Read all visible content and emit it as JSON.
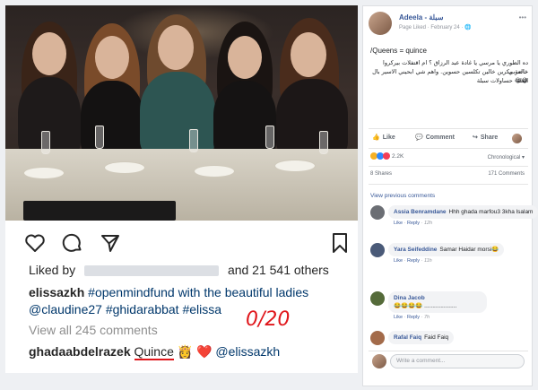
{
  "instagram": {
    "liked_by_prefix": "Liked by",
    "likes_suffix": "and 21 541 others",
    "caption": {
      "user": "elissazkh",
      "text_line1": "#openmindfund with the beautiful ladies",
      "text_line2": "@claudine27 #ghidarabbat #elissa"
    },
    "view_comments": "View all 245 comments",
    "comment": {
      "user": "ghadaabdelrazek",
      "word": "Quince",
      "emoji": "👸",
      "heart": "❤️",
      "mention": "@elissazkh"
    },
    "annotation": "0/20",
    "icons": [
      "heart-icon",
      "comment-icon",
      "share-icon",
      "bookmark-icon"
    ]
  },
  "facebook": {
    "page_name": "Adeela - سبلة",
    "meta": "Page Liked · February 24 · 🌐",
    "post_title": "/Queens = quince",
    "post_arabic": [
      "ده الطوري يا مرسي يا غادة عبد الرزاق ؟ ام اقتفلات بيركروا خالعربي",
      "خاصة مكرين خالين تكلسين حسوين. واهم شي ابحيني الاسير بال العلة",
      "😂😂 حساولات سبلة"
    ],
    "actions": {
      "like": "Like",
      "comment": "Comment",
      "share": "Share"
    },
    "reactions_count": "2.2K",
    "sort": "Chronological",
    "shares": "8 Shares",
    "comments_count": "171 Comments",
    "view_previous": "View previous comments",
    "comments": [
      {
        "name": "Assia Benramdane",
        "text": "Hhh ghada marfou3 3kha lsalam",
        "time": "12h"
      },
      {
        "name": "Yara Seifeddine",
        "text": "Samar Haidar morsi😂",
        "time": "11h"
      },
      {
        "name": "Dina Jacob",
        "text": "😂😂😂😂 ....................",
        "time": "7h"
      },
      {
        "name": "Rafal Faiq",
        "text": "Faid Faiq",
        "time": ""
      }
    ],
    "comment_meta_like": "Like",
    "comment_meta_reply": "Reply",
    "write_placeholder": "Write a comment..."
  },
  "colors": {
    "fb_link": "#385898",
    "ig_tag": "#00376b",
    "annotation_red": "#e0161b"
  }
}
